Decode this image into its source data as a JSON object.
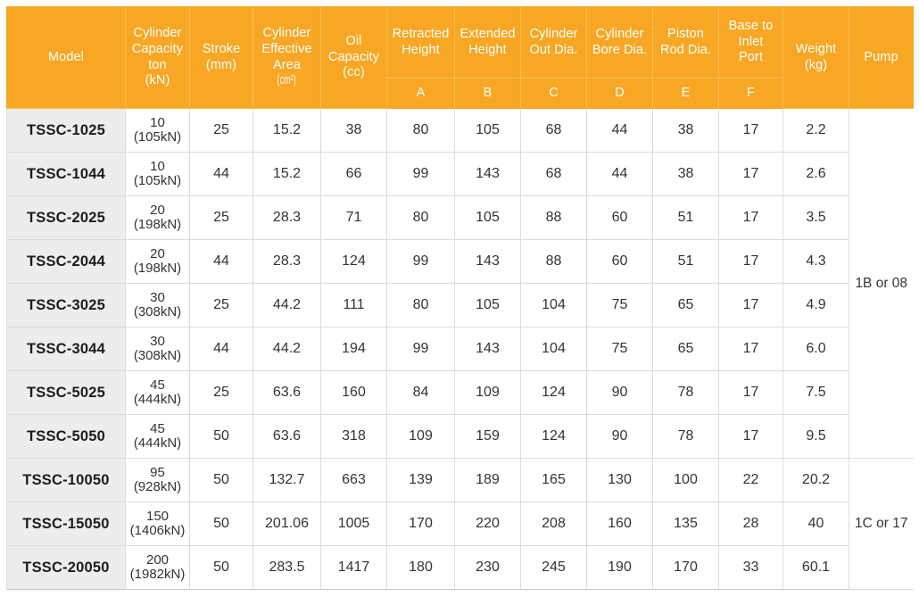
{
  "table": {
    "header": {
      "groups": [
        {
          "key": "model",
          "label": "Model",
          "sub": "",
          "layout": "tall"
        },
        {
          "key": "cap",
          "label": "Cylinder\nCapacity\nton\n(kN)",
          "sub": "",
          "layout": "tall"
        },
        {
          "key": "stroke",
          "label": "Stroke\n(mm)",
          "sub": "",
          "layout": "tall"
        },
        {
          "key": "area",
          "label": "Cylinder\nEffective\nArea\n(cm²)",
          "sub": "",
          "layout": "tall"
        },
        {
          "key": "oil",
          "label": "Oil\nCapacity\n(cc)",
          "sub": "",
          "layout": "tall"
        },
        {
          "key": "a",
          "label": "Retracted\nHeight",
          "sub": "A",
          "layout": "split"
        },
        {
          "key": "b",
          "label": "Extended\nHeight",
          "sub": "B",
          "layout": "split"
        },
        {
          "key": "c",
          "label": "Cylinder\nOut Dia.",
          "sub": "C",
          "layout": "split"
        },
        {
          "key": "d",
          "label": "Cylinder\nBore Dia.",
          "sub": "D",
          "layout": "split"
        },
        {
          "key": "e",
          "label": "Piston\nRod Dia.",
          "sub": "E",
          "layout": "split"
        },
        {
          "key": "f",
          "label": "Base to\nInlet\nPort",
          "sub": "F",
          "layout": "split"
        },
        {
          "key": "weight",
          "label": "Weight\n(kg)",
          "sub": "",
          "layout": "tall"
        },
        {
          "key": "pump",
          "label": "Pump",
          "sub": "",
          "layout": "tall"
        }
      ],
      "model": "Model",
      "cap_l1": "Cylinder",
      "cap_l2": "Capacity",
      "cap_l3": "ton",
      "cap_l4": "(kN)",
      "stroke_l1": "Stroke",
      "stroke_l2": "(mm)",
      "area_l1": "Cylinder",
      "area_l2": "Effective",
      "area_l3": "Area",
      "area_l4": "(cm²)",
      "oil_l1": "Oil",
      "oil_l2": "Capacity",
      "oil_l3": "(cc)",
      "a_l1": "Retracted",
      "a_l2": "Height",
      "a_sub": "A",
      "b_l1": "Extended",
      "b_l2": "Height",
      "b_sub": "B",
      "c_l1": "Cylinder",
      "c_l2": "Out Dia.",
      "c_sub": "C",
      "d_l1": "Cylinder",
      "d_l2": "Bore Dia.",
      "d_sub": "D",
      "e_l1": "Piston",
      "e_l2": "Rod Dia.",
      "e_sub": "E",
      "f_l1": "Base to",
      "f_l2": "Inlet",
      "f_l3": "Port",
      "f_sub": "F",
      "weight_l1": "Weight",
      "weight_l2": "(kg)",
      "pump": "Pump"
    },
    "rows": [
      {
        "model": "TSSC-1025",
        "cap_ton": "10",
        "cap_kn": "(105kN)",
        "stroke": "25",
        "area": "15.2",
        "oil": "38",
        "a": "80",
        "b": "105",
        "c": "68",
        "d": "44",
        "e": "38",
        "f": "17",
        "weight": "2.2"
      },
      {
        "model": "TSSC-1044",
        "cap_ton": "10",
        "cap_kn": "(105kN)",
        "stroke": "44",
        "area": "15.2",
        "oil": "66",
        "a": "99",
        "b": "143",
        "c": "68",
        "d": "44",
        "e": "38",
        "f": "17",
        "weight": "2.6"
      },
      {
        "model": "TSSC-2025",
        "cap_ton": "20",
        "cap_kn": "(198kN)",
        "stroke": "25",
        "area": "28.3",
        "oil": "71",
        "a": "80",
        "b": "105",
        "c": "88",
        "d": "60",
        "e": "51",
        "f": "17",
        "weight": "3.5"
      },
      {
        "model": "TSSC-2044",
        "cap_ton": "20",
        "cap_kn": "(198kN)",
        "stroke": "44",
        "area": "28.3",
        "oil": "124",
        "a": "99",
        "b": "143",
        "c": "88",
        "d": "60",
        "e": "51",
        "f": "17",
        "weight": "4.3"
      },
      {
        "model": "TSSC-3025",
        "cap_ton": "30",
        "cap_kn": "(308kN)",
        "stroke": "25",
        "area": "44.2",
        "oil": "111",
        "a": "80",
        "b": "105",
        "c": "104",
        "d": "75",
        "e": "65",
        "f": "17",
        "weight": "4.9"
      },
      {
        "model": "TSSC-3044",
        "cap_ton": "30",
        "cap_kn": "(308kN)",
        "stroke": "44",
        "area": "44.2",
        "oil": "194",
        "a": "99",
        "b": "143",
        "c": "104",
        "d": "75",
        "e": "65",
        "f": "17",
        "weight": "6.0"
      },
      {
        "model": "TSSC-5025",
        "cap_ton": "45",
        "cap_kn": "(444kN)",
        "stroke": "25",
        "area": "63.6",
        "oil": "160",
        "a": "84",
        "b": "109",
        "c": "124",
        "d": "90",
        "e": "78",
        "f": "17",
        "weight": "7.5"
      },
      {
        "model": "TSSC-5050",
        "cap_ton": "45",
        "cap_kn": "(444kN)",
        "stroke": "50",
        "area": "63.6",
        "oil": "318",
        "a": "109",
        "b": "159",
        "c": "124",
        "d": "90",
        "e": "78",
        "f": "17",
        "weight": "9.5"
      },
      {
        "model": "TSSC-10050",
        "cap_ton": "95",
        "cap_kn": "(928kN)",
        "stroke": "50",
        "area": "132.7",
        "oil": "663",
        "a": "139",
        "b": "189",
        "c": "165",
        "d": "130",
        "e": "100",
        "f": "22",
        "weight": "20.2"
      },
      {
        "model": "TSSC-15050",
        "cap_ton": "150",
        "cap_kn": "(1406kN)",
        "stroke": "50",
        "area": "201.06",
        "oil": "1005",
        "a": "170",
        "b": "220",
        "c": "208",
        "d": "160",
        "e": "135",
        "f": "28",
        "weight": "40"
      },
      {
        "model": "TSSC-20050",
        "cap_ton": "200",
        "cap_kn": "(1982kN)",
        "stroke": "50",
        "area": "283.5",
        "oil": "1417",
        "a": "180",
        "b": "230",
        "c": "245",
        "d": "190",
        "e": "170",
        "f": "33",
        "weight": "60.1"
      }
    ],
    "pump_groups": [
      {
        "label": "1B or 08",
        "span": 8
      },
      {
        "label": "1C or 17",
        "span": 3
      }
    ]
  },
  "colors": {
    "header_bg": "#f7a723",
    "header_border": "#f9bd56",
    "header_text": "#ffffff",
    "model_cell_bg": "#ededed",
    "cell_border": "#dcdcdc",
    "body_text": "#333333",
    "page_bg": "#ffffff"
  }
}
